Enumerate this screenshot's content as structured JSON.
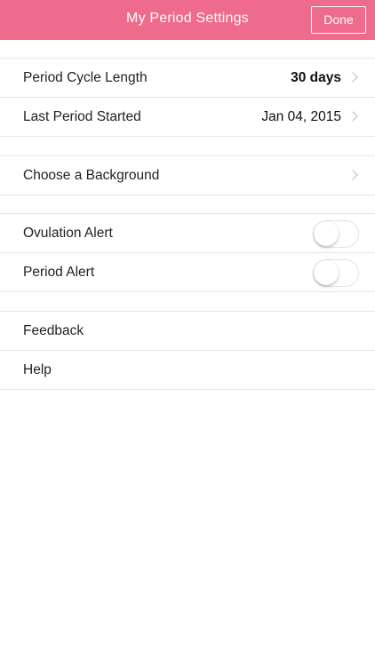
{
  "header": {
    "title": "My Period Settings",
    "done_label": "Done",
    "background_color": "#ee6b8b"
  },
  "cycle_group": {
    "cycle_length": {
      "label": "Period Cycle Length",
      "value": "30 days"
    },
    "last_started": {
      "label": "Last Period Started",
      "value": "Jan 04, 2015"
    }
  },
  "background_group": {
    "choose_background": {
      "label": "Choose a Background"
    }
  },
  "alerts_group": {
    "ovulation": {
      "label": "Ovulation Alert",
      "enabled": false
    },
    "period": {
      "label": "Period Alert",
      "enabled": false
    }
  },
  "support_group": {
    "feedback": {
      "label": "Feedback"
    },
    "help": {
      "label": "Help"
    }
  },
  "icons": {
    "chevron": "chevron-right-icon"
  }
}
